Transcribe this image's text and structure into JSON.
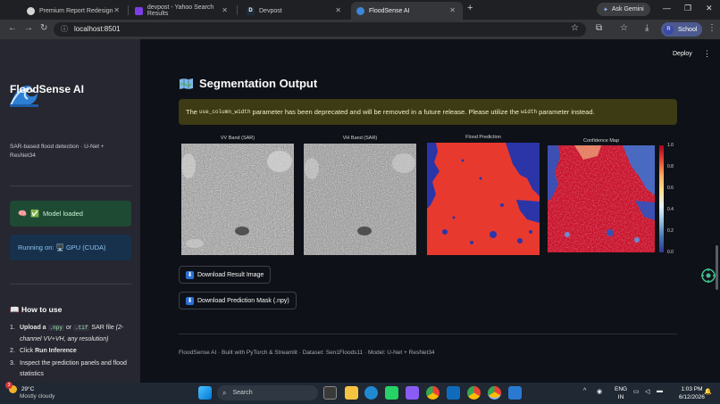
{
  "browser": {
    "tabs": [
      {
        "label": "Premium Report Redesign",
        "active": false
      },
      {
        "label": "devpost - Yahoo Search Results",
        "active": false
      },
      {
        "label": "Devpost",
        "active": false
      },
      {
        "label": "FloodSense AI",
        "active": true
      }
    ],
    "ask_gemini": "Ask Gemini",
    "url": "localhost:8501",
    "profile": "School",
    "profile_initial": "R"
  },
  "sidebar": {
    "title": "FloodSense AI",
    "subtitle": "SAR-based flood detection · U-Net + ResNet34",
    "status_model": "Model loaded",
    "status_device": "Running on: 🖥️ GPU (CUDA)",
    "howto_title": "How to use",
    "steps": [
      {
        "num": "1.",
        "pre": "Upload a",
        "ext1": ".npy",
        "mid": "or",
        "ext2": ".tif",
        "post": "SAR file",
        "note": "(2-channel VV+VH, any resolution)"
      },
      {
        "num": "2.",
        "pre": "Click",
        "bold": "Run Inference"
      },
      {
        "num": "3.",
        "text": "Inspect the prediction panels and flood statistics"
      }
    ]
  },
  "main": {
    "deploy": "Deploy",
    "section_title": "Segmentation Output",
    "warning": {
      "pre": "The",
      "code1": "use_column_width",
      "mid": "parameter has been deprecated and will be removed in a future release. Please utilize the",
      "code2": "width",
      "post": "parameter instead."
    },
    "panels": [
      {
        "title": "VV Band (SAR)"
      },
      {
        "title": "VH Band (SAR)"
      },
      {
        "title": "Flood Prediction"
      },
      {
        "title": "Confidence Map"
      }
    ],
    "colorbar_ticks": [
      "1.0",
      "0.8",
      "0.6",
      "0.4",
      "0.2",
      "0.0"
    ],
    "btn_download_image": "Download Result Image",
    "btn_download_mask": "Download Prediction Mask (.npy)",
    "footer": "FloodSense AI · Built with PyTorch & Streamlit · Dataset: Sen1Floods11 · Model: U-Net + ResNet34"
  },
  "taskbar": {
    "temp": "29°C",
    "weather": "Mostly cloudy",
    "search_placeholder": "Search",
    "lang1": "ENG",
    "lang2": "IN",
    "time": "1:03 PM",
    "date": "6/12/2026",
    "badge": "3"
  },
  "colors": {
    "sidebar_bg": "#262730",
    "main_bg": "#0e1117",
    "success_bg": "#1e4a34",
    "info_bg": "#17314c",
    "warning_bg": "#3d3b14",
    "flood_red": "#e8392e",
    "flood_blue": "#2b35a8"
  }
}
